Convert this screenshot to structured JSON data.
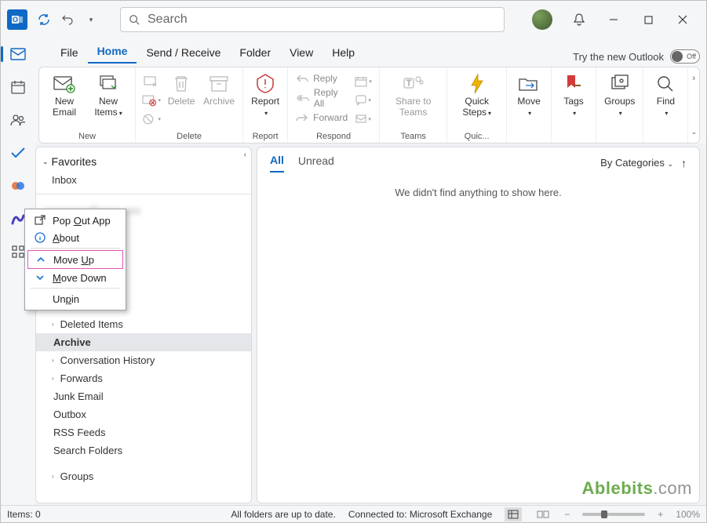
{
  "titlebar": {
    "search_placeholder": "Search"
  },
  "menubar": {
    "items": [
      "File",
      "Home",
      "Send / Receive",
      "Folder",
      "View",
      "Help"
    ],
    "active_index": 1,
    "try_new": "Try the new Outlook",
    "toggle_off": "Off"
  },
  "ribbon": {
    "new_email": "New Email",
    "new_items": "New Items",
    "group_new": "New",
    "delete": "Delete",
    "archive": "Archive",
    "group_delete": "Delete",
    "report": "Report",
    "group_report": "Report",
    "reply": "Reply",
    "reply_all": "Reply All",
    "forward": "Forward",
    "group_respond": "Respond",
    "share_teams": "Share to Teams",
    "group_teams": "Teams",
    "quick_steps": "Quick Steps",
    "group_quick": "Quic...",
    "move": "Move",
    "tags": "Tags",
    "groups": "Groups",
    "find": "Find"
  },
  "nav": {
    "favorites": "Favorites",
    "inbox": "Inbox",
    "account_blur": "xxxxxxxx@xxxx.xxx",
    "deleted": "Deleted Items",
    "archive": "Archive",
    "convhist": "Conversation History",
    "forwards": "Forwards",
    "junk": "Junk Email",
    "outbox": "Outbox",
    "rss": "RSS Feeds",
    "searchfolders": "Search Folders",
    "groups": "Groups"
  },
  "readpane": {
    "tab_all": "All",
    "tab_unread": "Unread",
    "by_cat": "By Categories",
    "empty": "We didn't find anything to show here."
  },
  "context_menu": {
    "popout_pre": "Pop ",
    "popout_u": "O",
    "popout_post": "ut App",
    "about_u": "A",
    "about_post": "bout",
    "moveup_pre": "Move ",
    "moveup_u": "U",
    "moveup_post": "p",
    "movedown_u": "M",
    "movedown_post": "ove Down",
    "unpin_pre": "Un",
    "unpin_u": "p",
    "unpin_post": "in"
  },
  "statusbar": {
    "items_count": "Items: 0",
    "folders_status": "All folders are up to date.",
    "connected": "Connected to: Microsoft Exchange",
    "zoom": "100%"
  },
  "watermark": {
    "brand": "Ablebits",
    "suffix": ".com"
  }
}
